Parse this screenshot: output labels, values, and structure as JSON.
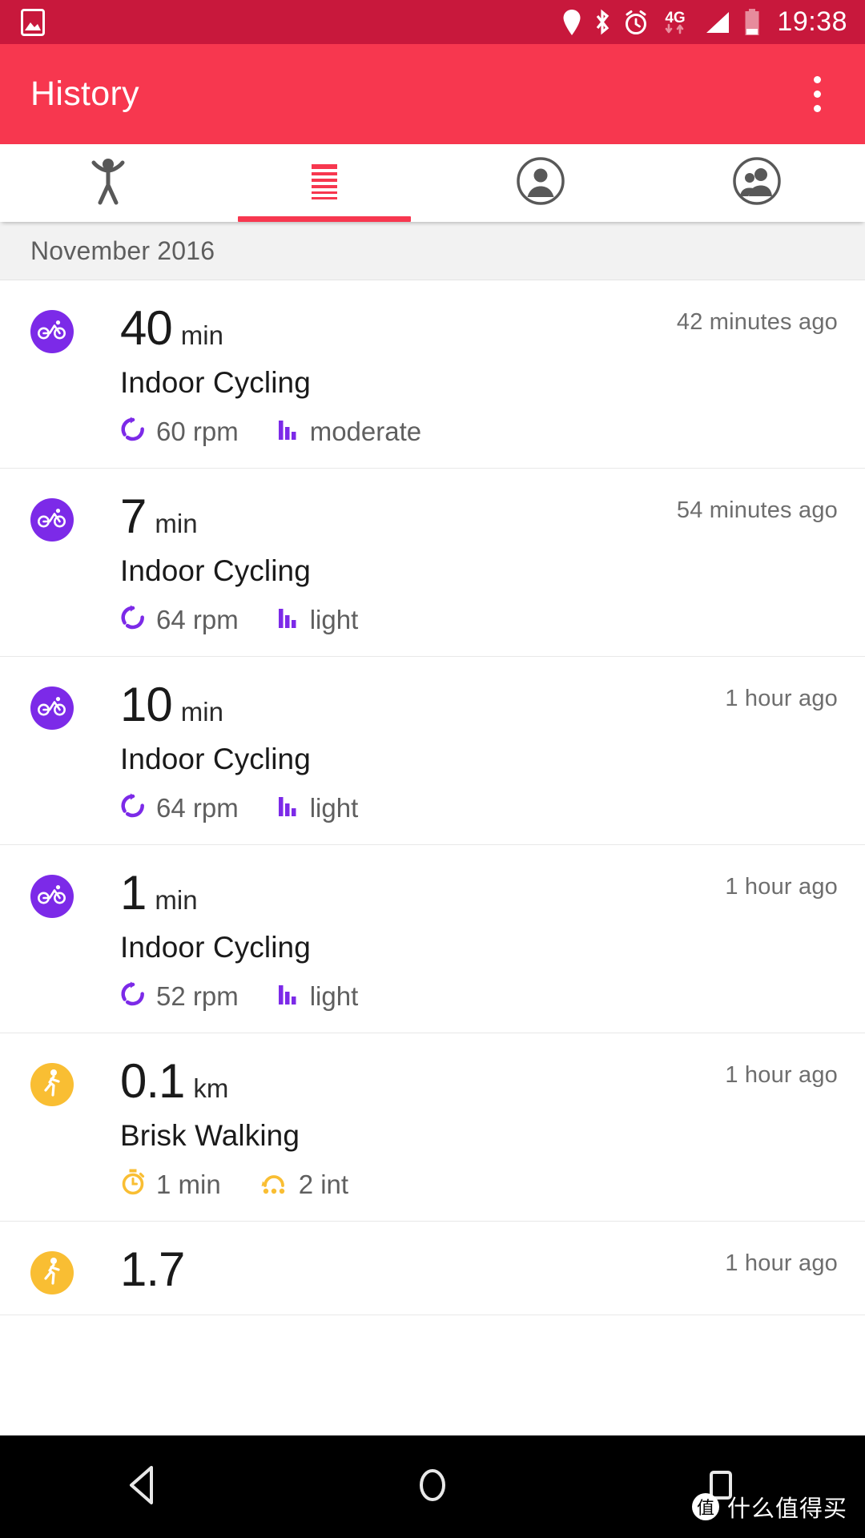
{
  "statusbar": {
    "time": "19:38",
    "icons": [
      "photo-icon",
      "location-icon",
      "bluetooth-icon",
      "alarm-icon",
      "network-4g-icon",
      "signal-icon",
      "battery-icon"
    ],
    "network_label": "4G",
    "background_color": "#C8183C"
  },
  "appbar": {
    "title": "History",
    "overflow_label": "More options",
    "background_color": "#F7374F"
  },
  "tabs": {
    "active_index": 1,
    "indicator_color": "#F7374F",
    "items": [
      {
        "name": "activity",
        "icon": "person-activity-icon",
        "active": false
      },
      {
        "name": "history",
        "icon": "list-lines-icon",
        "active": true
      },
      {
        "name": "profile",
        "icon": "account-circle-icon",
        "active": false
      },
      {
        "name": "friends",
        "icon": "people-circle-icon",
        "active": false
      }
    ]
  },
  "month_header": {
    "label": "November 2016"
  },
  "colors": {
    "cycling": "#7C2AE8",
    "walking": "#F9BE33"
  },
  "activities": [
    {
      "icon": "bike-icon",
      "accent": "#7C2AE8",
      "value": "40",
      "unit": "min",
      "name": "Indoor Cycling",
      "time_ago": "42 minutes ago",
      "metrics": [
        {
          "icon": "cadence-icon",
          "text": "60 rpm"
        },
        {
          "icon": "intensity-bars-icon",
          "text": "moderate"
        }
      ]
    },
    {
      "icon": "bike-icon",
      "accent": "#7C2AE8",
      "value": "7",
      "unit": "min",
      "name": "Indoor Cycling",
      "time_ago": "54 minutes ago",
      "metrics": [
        {
          "icon": "cadence-icon",
          "text": "64 rpm"
        },
        {
          "icon": "intensity-bars-icon",
          "text": "light"
        }
      ]
    },
    {
      "icon": "bike-icon",
      "accent": "#7C2AE8",
      "value": "10",
      "unit": "min",
      "name": "Indoor Cycling",
      "time_ago": "1 hour ago",
      "metrics": [
        {
          "icon": "cadence-icon",
          "text": "64 rpm"
        },
        {
          "icon": "intensity-bars-icon",
          "text": "light"
        }
      ]
    },
    {
      "icon": "bike-icon",
      "accent": "#7C2AE8",
      "value": "1",
      "unit": "min",
      "name": "Indoor Cycling",
      "time_ago": "1 hour ago",
      "metrics": [
        {
          "icon": "cadence-icon",
          "text": "52 rpm"
        },
        {
          "icon": "intensity-bars-icon",
          "text": "light"
        }
      ]
    },
    {
      "icon": "run-icon",
      "accent": "#F9BE33",
      "value": "0.1",
      "unit": "km",
      "name": "Brisk Walking",
      "time_ago": "1 hour ago",
      "metrics": [
        {
          "icon": "stopwatch-icon",
          "text": "1 min"
        },
        {
          "icon": "intervals-icon",
          "text": "2 int"
        }
      ]
    },
    {
      "icon": "run-icon",
      "accent": "#F9BE33",
      "value": "1.7",
      "unit": "",
      "name": "",
      "time_ago": "1 hour ago",
      "metrics": []
    }
  ],
  "navbar": {
    "buttons": [
      {
        "name": "back",
        "icon": "back-triangle-icon"
      },
      {
        "name": "home",
        "icon": "home-circle-icon"
      },
      {
        "name": "recents",
        "icon": "recents-square-icon"
      }
    ],
    "watermark": {
      "badge": "值",
      "text": "什么值得买"
    }
  }
}
